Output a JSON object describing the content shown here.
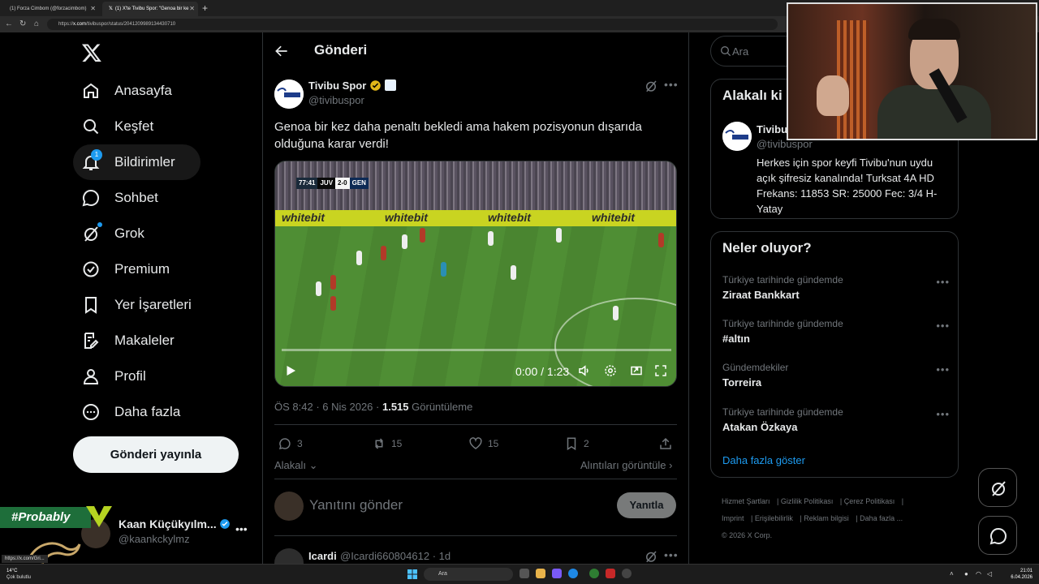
{
  "browser": {
    "tabs": [
      {
        "title": "(1) Forza Cimbom (@forzacimbom)",
        "active": false
      },
      {
        "title": "(1) X'te Tivibu Spor: \"Genoa bir ke",
        "active": true
      }
    ],
    "url_prefix": "https://",
    "url_domain": "x.com",
    "url_path": "/tivibuspor/status/2041209989134430710"
  },
  "nav": {
    "items": [
      {
        "label": "Anasayfa",
        "icon": "home-icon"
      },
      {
        "label": "Keşfet",
        "icon": "search-icon"
      },
      {
        "label": "Bildirimler",
        "icon": "bell-icon",
        "badge": "1"
      },
      {
        "label": "Sohbet",
        "icon": "chat-icon"
      },
      {
        "label": "Grok",
        "icon": "grok-icon"
      },
      {
        "label": "Premium",
        "icon": "premium-icon"
      },
      {
        "label": "Yer İşaretleri",
        "icon": "bookmark-icon"
      },
      {
        "label": "Makaleler",
        "icon": "articles-icon"
      },
      {
        "label": "Profil",
        "icon": "profile-icon"
      },
      {
        "label": "Daha fazla",
        "icon": "more-icon"
      }
    ],
    "post_button": "Gönderi yayınla"
  },
  "account": {
    "name": "Kaan Küçükyılm...",
    "handle": "@kaankckylmz",
    "overlay_tag": "#Probably"
  },
  "status_link": "https://x.com/Gri...",
  "header": {
    "title": "Gönderi"
  },
  "tweet": {
    "author": "Tivibu Spor",
    "handle": "@tivibuspor",
    "text": "Genoa bir kez daha penaltı bekledi ama hakem pozisyonun dışarıda olduğuna karar verdi!",
    "video": {
      "scoreboard": {
        "time": "77:41",
        "home": "JUV",
        "score": "2-0",
        "away": "GEN"
      },
      "ad_text": "whitebit",
      "time_display": "0:00 / 1:23",
      "progress": 0.0
    },
    "time": "ÖS 8:42",
    "date": "6 Nis 2026",
    "views_count": "1.515",
    "views_label": "Görüntüleme",
    "replies": "3",
    "retweets": "15",
    "likes": "15",
    "bookmarks": "2",
    "relevant_label": "Alakalı",
    "quotes_label": "Alıntıları görüntüle"
  },
  "reply_box": {
    "placeholder": "Yanıtını gönder",
    "button": "Yanıtla"
  },
  "next_tweet": {
    "author": "Icardi",
    "handle": "@Icardi660804612",
    "time": "· 1d"
  },
  "right": {
    "search_placeholder": "Ara",
    "related": {
      "title": "Alakalı ki",
      "name": "Tivibu",
      "handle": "@tivibuspor",
      "bio": "Herkes için spor keyfi Tivibu'nun uydu açık şifresiz kanalında! Turksat 4A HD Frekans: 11853 SR: 25000 Fec: 3/4 H-Yatay"
    },
    "trends": {
      "title": "Neler oluyor?",
      "items": [
        {
          "context": "Türkiye tarihinde gündemde",
          "name": "Ziraat Bankkart"
        },
        {
          "context": "Türkiye tarihinde gündemde",
          "name": "#altın"
        },
        {
          "context": "Gündemdekiler",
          "name": "Torreira"
        },
        {
          "context": "Türkiye tarihinde gündemde",
          "name": "Atakan Özkaya"
        }
      ],
      "show_more": "Daha fazla göster"
    },
    "footer": {
      "links": [
        "Hizmet Şartları",
        "Gizlilik Politikası",
        "Çerez Politikası",
        "Imprint",
        "Erişilebilirlik",
        "Reklam bilgisi",
        "Daha fazla ..."
      ],
      "copyright": "© 2026 X Corp."
    }
  },
  "taskbar": {
    "weather_temp": "14°C",
    "weather_desc": "Çok bulutlu",
    "search_placeholder": "Ara",
    "time": "21:01",
    "date": "6.04.2026"
  },
  "colors": {
    "accent": "#1d9bf0",
    "background": "#000000",
    "border": "#2f3336",
    "muted": "#71767b",
    "gold": "#e2b719"
  }
}
